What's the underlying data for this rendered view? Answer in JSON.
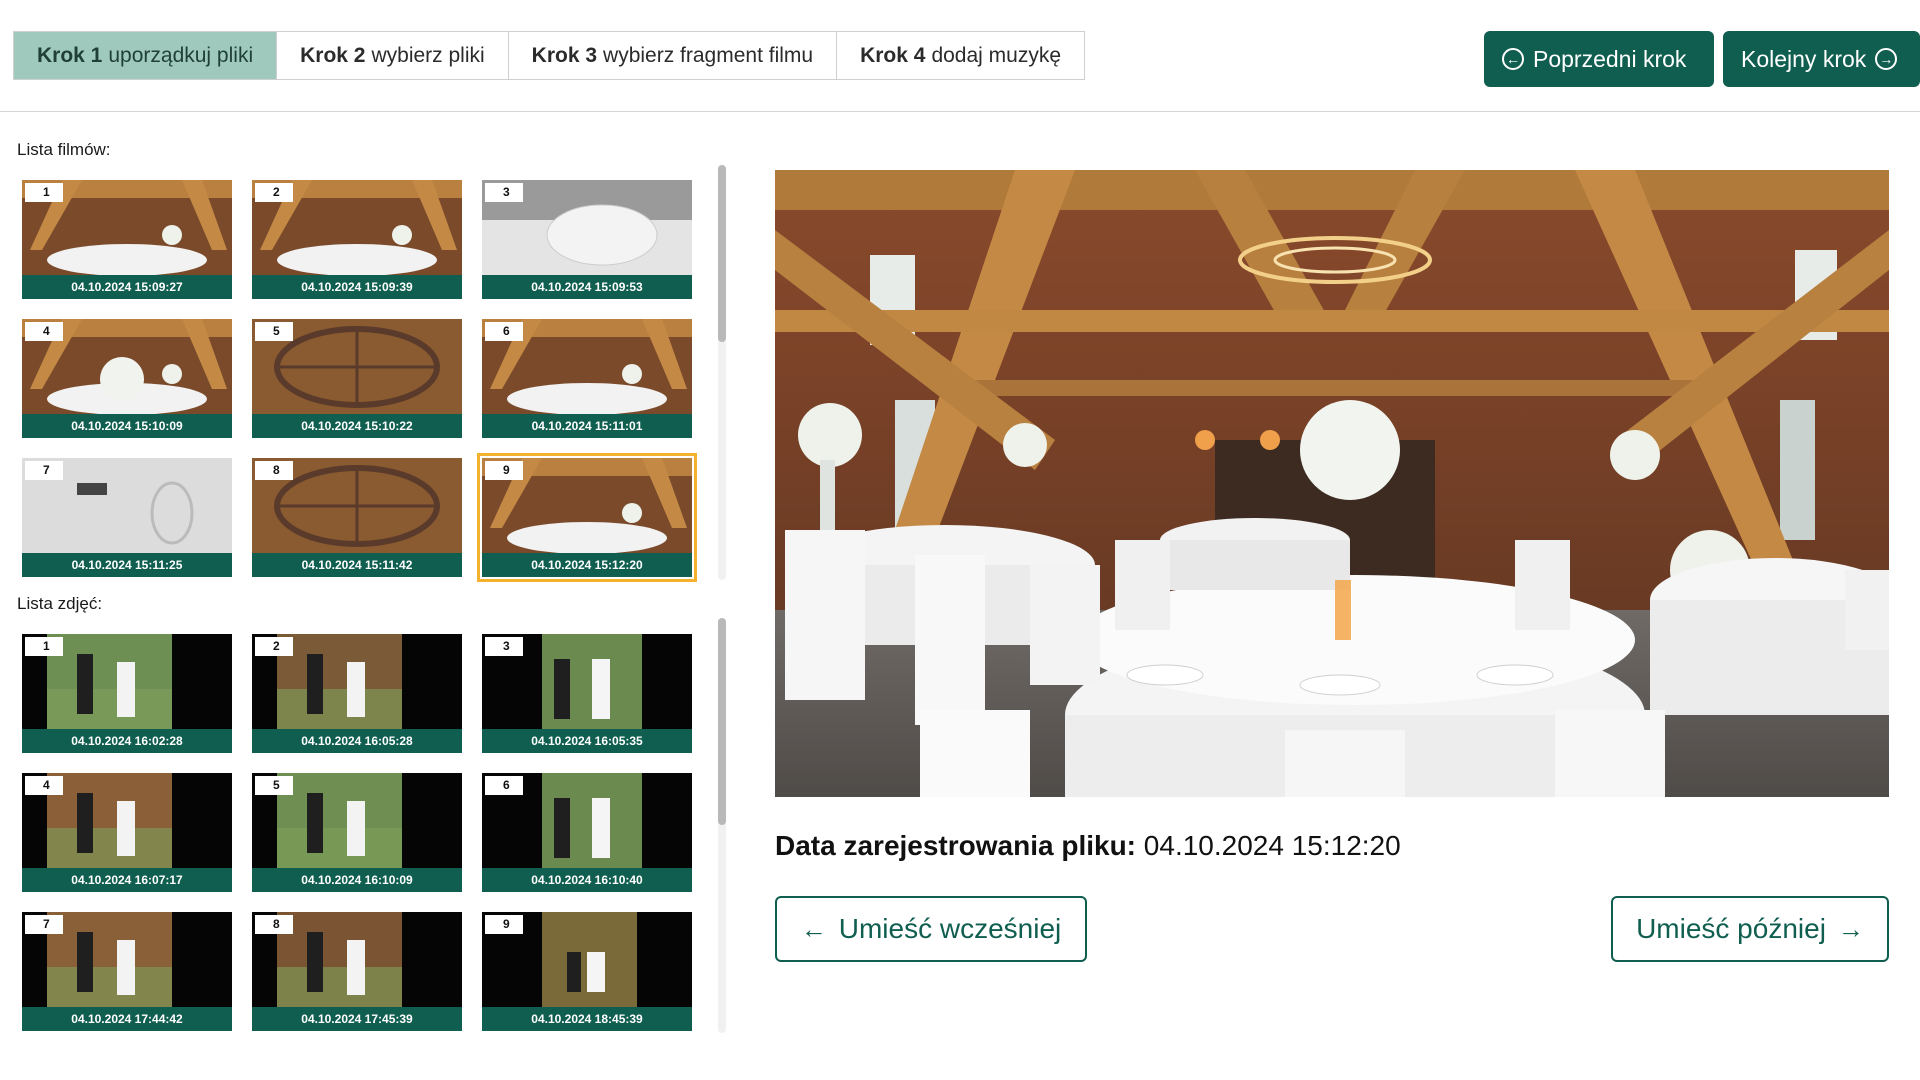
{
  "steps": [
    {
      "num": "Krok 1",
      "label": "uporządkuj pliki",
      "active": true
    },
    {
      "num": "Krok 2",
      "label": "wybierz pliki",
      "active": false
    },
    {
      "num": "Krok 3",
      "label": "wybierz fragment filmu",
      "active": false
    },
    {
      "num": "Krok 4",
      "label": "dodaj muzykę",
      "active": false
    }
  ],
  "nav": {
    "prev_label": "Poprzedni krok",
    "next_label": "Kolejny krok"
  },
  "films": {
    "label": "Lista filmów:",
    "items": [
      {
        "num": "1",
        "date": "04.10.2024 15:09:27"
      },
      {
        "num": "2",
        "date": "04.10.2024 15:09:39"
      },
      {
        "num": "3",
        "date": "04.10.2024 15:09:53"
      },
      {
        "num": "4",
        "date": "04.10.2024 15:10:09"
      },
      {
        "num": "5",
        "date": "04.10.2024 15:10:22"
      },
      {
        "num": "6",
        "date": "04.10.2024 15:11:01"
      },
      {
        "num": "7",
        "date": "04.10.2024 15:11:25"
      },
      {
        "num": "8",
        "date": "04.10.2024 15:11:42"
      },
      {
        "num": "9",
        "date": "04.10.2024 15:12:20"
      }
    ],
    "selected_index": 8
  },
  "photos": {
    "label": "Lista zdjęć:",
    "items": [
      {
        "num": "1",
        "date": "04.10.2024 16:02:28"
      },
      {
        "num": "2",
        "date": "04.10.2024 16:05:28"
      },
      {
        "num": "3",
        "date": "04.10.2024 16:05:35"
      },
      {
        "num": "4",
        "date": "04.10.2024 16:07:17"
      },
      {
        "num": "5",
        "date": "04.10.2024 16:10:09"
      },
      {
        "num": "6",
        "date": "04.10.2024 16:10:40"
      },
      {
        "num": "7",
        "date": "04.10.2024 17:44:42"
      },
      {
        "num": "8",
        "date": "04.10.2024 17:45:39"
      },
      {
        "num": "9",
        "date": "04.10.2024 18:45:39"
      }
    ]
  },
  "details": {
    "date_label": "Data zarejestrowania pliku:",
    "date_value": "04.10.2024 15:12:20"
  },
  "actions": {
    "earlier_label": "Umieść wcześniej",
    "later_label": "Umieść później"
  },
  "colors": {
    "primary": "#0f5e4f",
    "active_step": "#9fc9bd",
    "selection": "#f3b12d"
  }
}
